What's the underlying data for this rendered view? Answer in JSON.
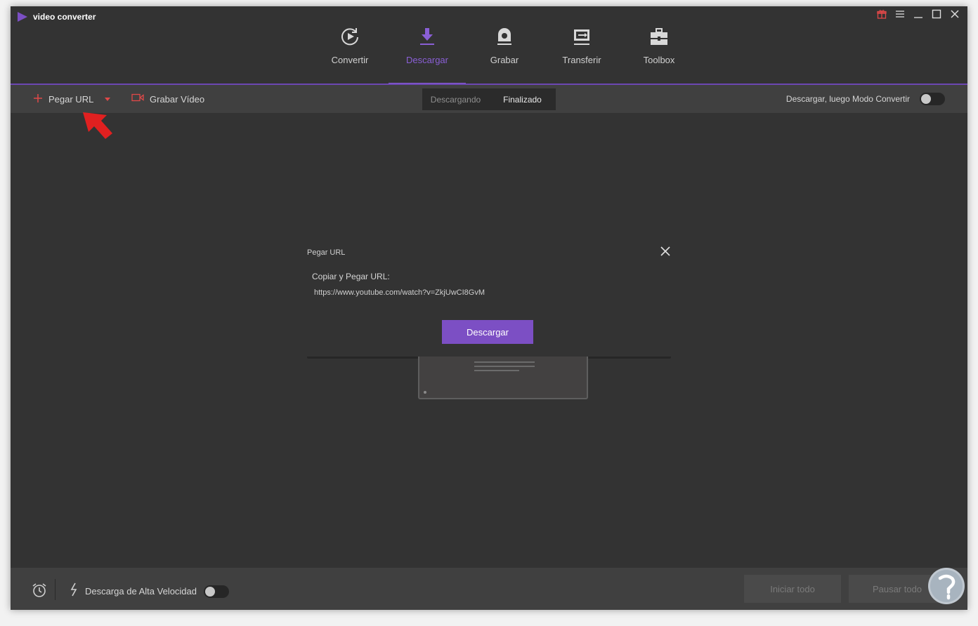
{
  "app": {
    "title": "video converter"
  },
  "window_controls": [
    "gift-icon",
    "menu-icon",
    "minimize-icon",
    "maximize-icon",
    "close-icon"
  ],
  "nav": {
    "items": [
      {
        "label": "Convertir",
        "icon": "convert-icon",
        "active": false
      },
      {
        "label": "Descargar",
        "icon": "download-icon",
        "active": true
      },
      {
        "label": "Grabar",
        "icon": "record-icon",
        "active": false
      },
      {
        "label": "Transferir",
        "icon": "transfer-icon",
        "active": false
      },
      {
        "label": "Toolbox",
        "icon": "toolbox-icon",
        "active": false
      }
    ]
  },
  "toolbar": {
    "paste_url": "Pegar URL",
    "record_video": "Grabar Vídeo",
    "tabs": [
      {
        "label": "Descargando",
        "active": false
      },
      {
        "label": "Finalizado",
        "active": true
      }
    ],
    "download_then_convert": "Descargar, luego Modo Convertir",
    "download_then_convert_on": false
  },
  "dialog": {
    "title": "Pegar URL",
    "label": "Copiar y Pegar URL:",
    "url_value": "https://www.youtube.com/watch?v=ZkjUwCI8GvM",
    "button": "Descargar"
  },
  "bottom": {
    "high_speed": "Descarga de Alta Velocidad",
    "high_speed_on": false,
    "start_all": "Iniciar todo",
    "pause_all": "Pausar todo"
  },
  "colors": {
    "accent": "#7c4fc4",
    "annotation": "#e02020",
    "background": "#333333"
  }
}
